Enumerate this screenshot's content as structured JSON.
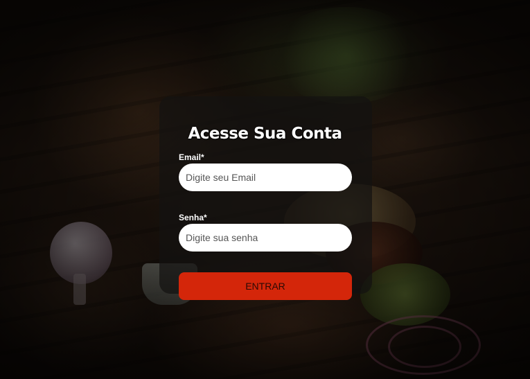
{
  "login": {
    "title": "Acesse Sua Conta",
    "email_label": "Email*",
    "email_placeholder": "Digite seu Email",
    "email_value": "",
    "password_label": "Senha*",
    "password_placeholder": "Digite sua senha",
    "password_value": "",
    "submit_label": "ENTRAR"
  },
  "colors": {
    "accent": "#d4260a",
    "card_background": "#141210",
    "input_background": "#ffffff"
  }
}
